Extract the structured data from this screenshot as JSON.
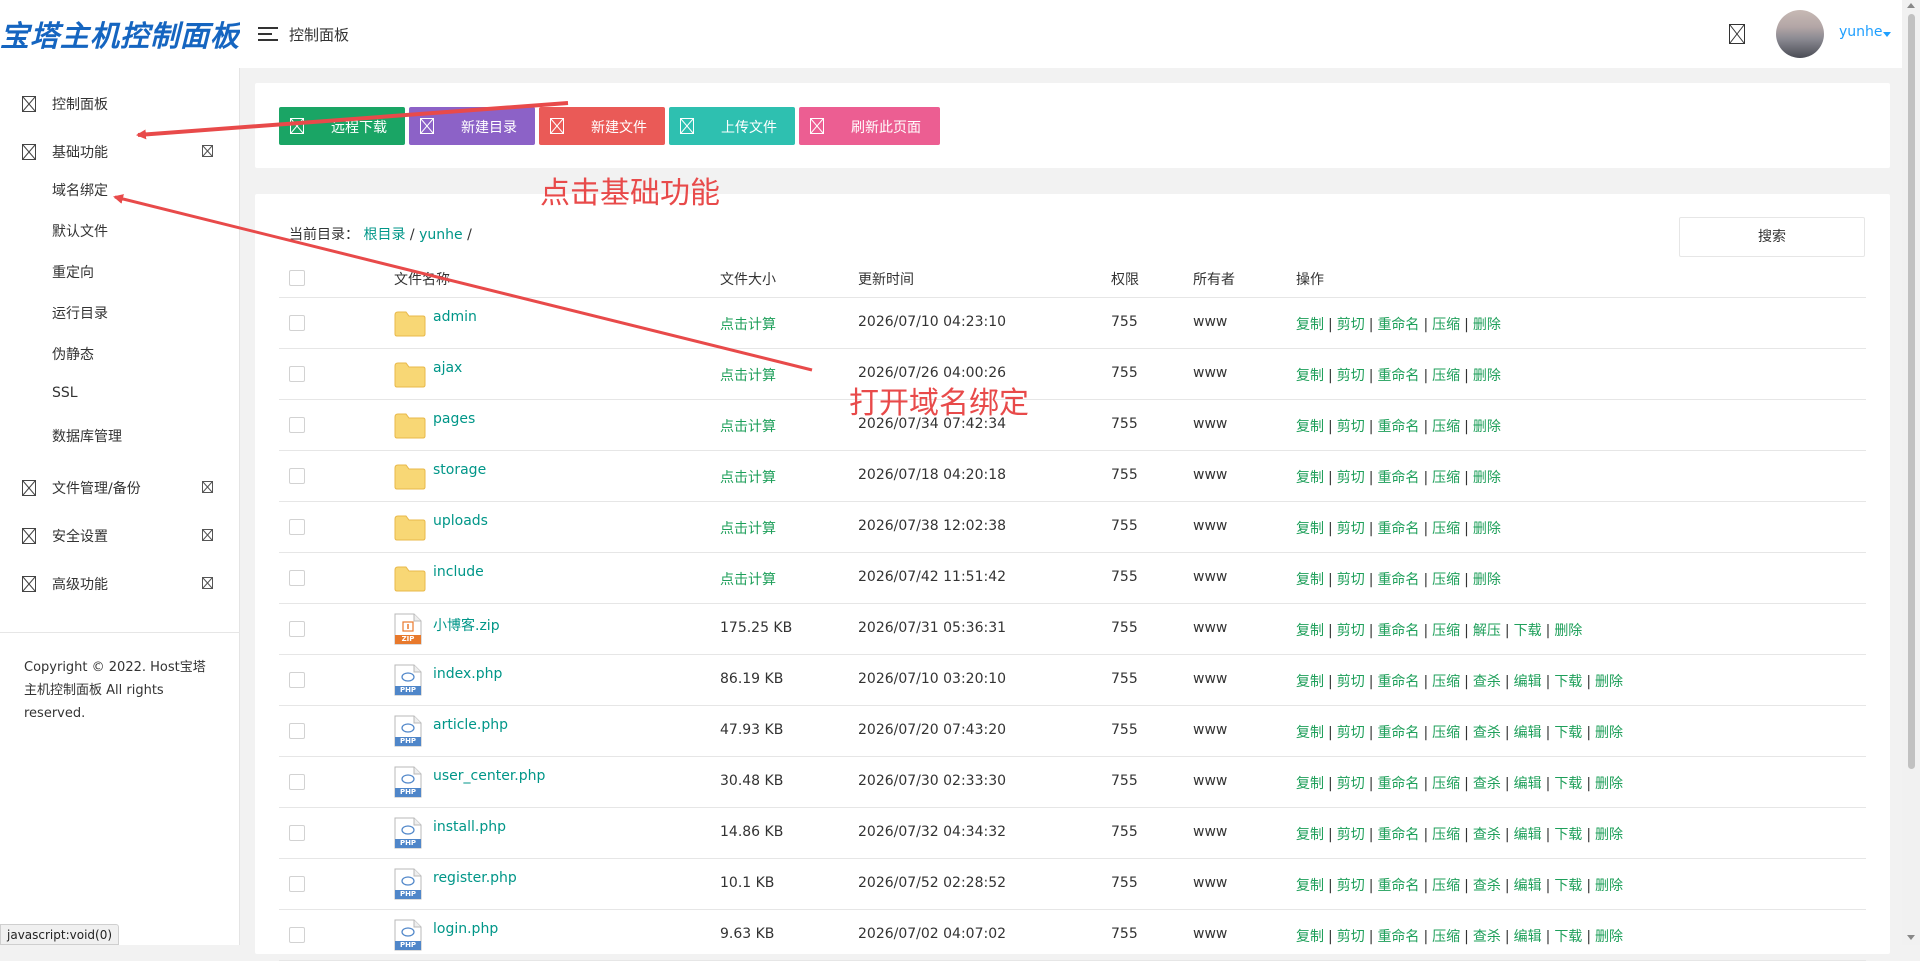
{
  "app": {
    "logo_text": "宝塔主机控制面板",
    "header_title": "控制面板",
    "user_name": "yunhe"
  },
  "sidebar": {
    "items": [
      {
        "label": "控制面板"
      },
      {
        "label": "基础功能"
      },
      {
        "label": "文件管理/备份"
      },
      {
        "label": "安全设置"
      },
      {
        "label": "高级功能"
      }
    ],
    "subitems": [
      "域名绑定",
      "默认文件",
      "重定向",
      "运行目录",
      "伪静态",
      "SSL",
      "数据库管理"
    ],
    "copyright": "Copyright © 2022. Host宝塔主机控制面板 All rights reserved."
  },
  "toolbar": {
    "buttons": [
      {
        "label": "远程下载",
        "color": "#1aa565"
      },
      {
        "label": "新建目录",
        "color": "#8c62c7"
      },
      {
        "label": "新建文件",
        "color": "#ea5a57"
      },
      {
        "label": "上传文件",
        "color": "#2ec0b0"
      },
      {
        "label": "刷新此页面",
        "color": "#ec5e92"
      }
    ]
  },
  "breadcrumb": {
    "prefix": "当前目录：",
    "root": "根目录",
    "sep1": "/",
    "current": "yunhe",
    "sep2": "/"
  },
  "search_label": "搜索",
  "table": {
    "headers": [
      "文件名称",
      "文件大小",
      "更新时间",
      "权限",
      "所有者",
      "操作"
    ],
    "calc_label": "点击计算",
    "rows": [
      {
        "type": "folder",
        "name": "admin",
        "size": "点击计算",
        "time": "2026/07/10 04:23:10",
        "perm": "755",
        "owner": "www",
        "ops": [
          "复制",
          "剪切",
          "重命名",
          "压缩",
          "删除"
        ]
      },
      {
        "type": "folder",
        "name": "ajax",
        "size": "点击计算",
        "time": "2026/07/26 04:00:26",
        "perm": "755",
        "owner": "www",
        "ops": [
          "复制",
          "剪切",
          "重命名",
          "压缩",
          "删除"
        ]
      },
      {
        "type": "folder",
        "name": "pages",
        "size": "点击计算",
        "time": "2026/07/34 07:42:34",
        "perm": "755",
        "owner": "www",
        "ops": [
          "复制",
          "剪切",
          "重命名",
          "压缩",
          "删除"
        ]
      },
      {
        "type": "folder",
        "name": "storage",
        "size": "点击计算",
        "time": "2026/07/18 04:20:18",
        "perm": "755",
        "owner": "www",
        "ops": [
          "复制",
          "剪切",
          "重命名",
          "压缩",
          "删除"
        ]
      },
      {
        "type": "folder",
        "name": "uploads",
        "size": "点击计算",
        "time": "2026/07/38 12:02:38",
        "perm": "755",
        "owner": "www",
        "ops": [
          "复制",
          "剪切",
          "重命名",
          "压缩",
          "删除"
        ]
      },
      {
        "type": "folder",
        "name": "include",
        "size": "点击计算",
        "time": "2026/07/42 11:51:42",
        "perm": "755",
        "owner": "www",
        "ops": [
          "复制",
          "剪切",
          "重命名",
          "压缩",
          "删除"
        ]
      },
      {
        "type": "zip",
        "icon_text": "ZIP",
        "name": "小博客.zip",
        "size": "175.25 KB",
        "time": "2026/07/31 05:36:31",
        "perm": "755",
        "owner": "www",
        "ops": [
          "复制",
          "剪切",
          "重命名",
          "压缩",
          "解压",
          "下载",
          "删除"
        ]
      },
      {
        "type": "php",
        "icon_text": "PHP",
        "name": "index.php",
        "size": "86.19 KB",
        "time": "2026/07/10 03:20:10",
        "perm": "755",
        "owner": "www",
        "ops": [
          "复制",
          "剪切",
          "重命名",
          "压缩",
          "查杀",
          "编辑",
          "下载",
          "删除"
        ]
      },
      {
        "type": "php",
        "icon_text": "PHP",
        "name": "article.php",
        "size": "47.93 KB",
        "time": "2026/07/20 07:43:20",
        "perm": "755",
        "owner": "www",
        "ops": [
          "复制",
          "剪切",
          "重命名",
          "压缩",
          "查杀",
          "编辑",
          "下载",
          "删除"
        ]
      },
      {
        "type": "php",
        "icon_text": "PHP",
        "name": "user_center.php",
        "size": "30.48 KB",
        "time": "2026/07/30 02:33:30",
        "perm": "755",
        "owner": "www",
        "ops": [
          "复制",
          "剪切",
          "重命名",
          "压缩",
          "查杀",
          "编辑",
          "下载",
          "删除"
        ]
      },
      {
        "type": "php",
        "icon_text": "PHP",
        "name": "install.php",
        "size": "14.86 KB",
        "time": "2026/07/32 04:34:32",
        "perm": "755",
        "owner": "www",
        "ops": [
          "复制",
          "剪切",
          "重命名",
          "压缩",
          "查杀",
          "编辑",
          "下载",
          "删除"
        ]
      },
      {
        "type": "php",
        "icon_text": "PHP",
        "name": "register.php",
        "size": "10.1 KB",
        "time": "2026/07/52 02:28:52",
        "perm": "755",
        "owner": "www",
        "ops": [
          "复制",
          "剪切",
          "重命名",
          "压缩",
          "查杀",
          "编辑",
          "下载",
          "删除"
        ]
      },
      {
        "type": "php",
        "icon_text": "PHP",
        "name": "login.php",
        "size": "9.63 KB",
        "time": "2026/07/02 04:07:02",
        "perm": "755",
        "owner": "www",
        "ops": [
          "复制",
          "剪切",
          "重命名",
          "压缩",
          "查杀",
          "编辑",
          "下载",
          "删除"
        ]
      }
    ]
  },
  "annotations": {
    "text1": "点击基础功能",
    "text2": "打开域名绑定",
    "color": "#e84a4a"
  },
  "status_bar": "javascript:void(0)"
}
